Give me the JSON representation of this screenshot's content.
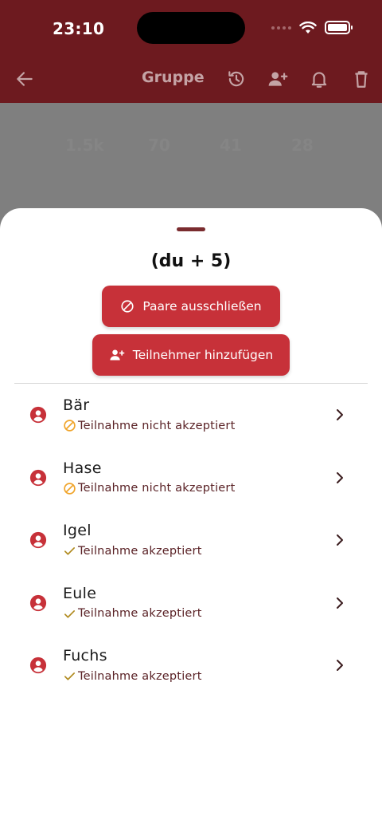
{
  "status_bar": {
    "time": "23:10"
  },
  "app_bar": {
    "title": "Gruppe",
    "icons": [
      "back-arrow-icon",
      "history-icon",
      "add-person-icon",
      "bell-icon",
      "trash-icon"
    ]
  },
  "background_stats": [
    "1.5k",
    "70",
    "41",
    "28"
  ],
  "sheet": {
    "title": "(du + 5)",
    "exclude_pairs_label": "Paare ausschließen",
    "add_participant_label": "Teilnehmer hinzufügen"
  },
  "participants": [
    {
      "name": "Bär",
      "status": "Teilnahme nicht akzeptiert",
      "state": "not-accepted"
    },
    {
      "name": "Hase",
      "status": "Teilnahme nicht akzeptiert",
      "state": "not-accepted"
    },
    {
      "name": "Igel",
      "status": "Teilnahme akzeptiert",
      "state": "accepted"
    },
    {
      "name": "Eule",
      "status": "Teilnahme akzeptiert",
      "state": "accepted"
    },
    {
      "name": "Fuchs",
      "status": "Teilnahme akzeptiert",
      "state": "accepted"
    }
  ],
  "colors": {
    "app_bar": "#6d1a1f",
    "accent": "#c73139",
    "not_accepted_icon": "#f0a42a",
    "accepted_icon": "#b08a1e",
    "status_text": "#5a2226"
  }
}
